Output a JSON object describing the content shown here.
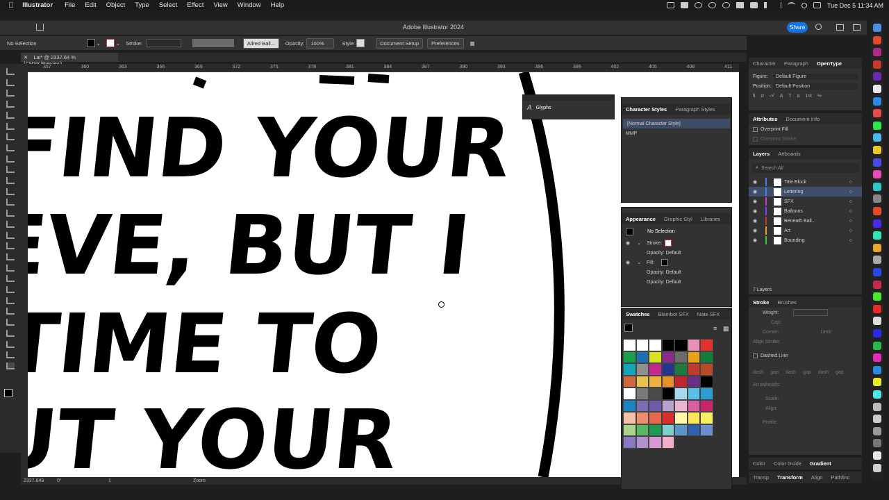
{
  "menubar": {
    "app": "Illustrator",
    "items": [
      "File",
      "Edit",
      "Object",
      "Type",
      "Select",
      "Effect",
      "View",
      "Window",
      "Help"
    ],
    "clock": "Tue Dec 5  11:34 AM"
  },
  "window": {
    "title": "Adobe Illustrator 2024",
    "share_label": "Share"
  },
  "control": {
    "selection": "No Selection",
    "stroke_label": "Stroke:",
    "font": "Allred Ball...",
    "opacity_label": "Opacity:",
    "opacity_value": "100%",
    "style_label": "Style:",
    "doc_setup": "Document Setup",
    "preferences": "Preferences"
  },
  "document_tab": "Lai* @ 2337.64 % (CMYK/Preview)",
  "ruler": [
    "357",
    "360",
    "363",
    "366",
    "369",
    "372",
    "375",
    "378",
    "381",
    "384",
    "387",
    "390",
    "393",
    "396",
    "399",
    "402",
    "405",
    "408",
    "411"
  ],
  "canvas_text": [
    "FIND YOUR",
    "EVE, BUT I",
    "TIME TO",
    "UT YOUR"
  ],
  "status": {
    "zoom": "2337.649",
    "angle": "0°",
    "artboard": "1",
    "tool": "Zoom"
  },
  "glyphs_panel": {
    "title": "Glyphs"
  },
  "char_styles_panel": {
    "tabs": [
      "Character Styles",
      "Paragraph Styles"
    ],
    "items": [
      "[Normal Character Style]",
      "MMP"
    ]
  },
  "appearance_panel": {
    "tabs": [
      "Appearance",
      "Graphic Styl",
      "Libraries"
    ],
    "selection": "No Selection",
    "stroke_label": "Stroke:",
    "fill_label": "Fill:",
    "opacity_rows": [
      "Opacity: Default",
      "Opacity: Default",
      "Opacity: Default"
    ]
  },
  "swatches_panel": {
    "tabs": [
      "Swatches",
      "Blambot SFX",
      "Nate SFX"
    ],
    "colors": [
      "#ffffff",
      "#ffffff",
      "#ffffff",
      "#000000",
      "#000000",
      "#e991b4",
      "#e2322b",
      "#1aa04a",
      "#1e6fb2",
      "#d9e21f",
      "#8a2a8a",
      "#6b6b6b",
      "#e6a318",
      "#137e3b",
      "#14a6b8",
      "#8f8f8f",
      "#c02a8c",
      "#26358f",
      "#1c7a3e",
      "#c23a2a",
      "#b84b27",
      "#d06a3a",
      "#e8c24a",
      "#f0b23d",
      "#e8912a",
      "#c2262b",
      "#6a2e8a",
      "#000000",
      "#ffffff",
      "#7a7a7a",
      "#4a4a4a",
      "#000000",
      "#a8d8ee",
      "#58c1e8",
      "#2a9fd6",
      "#1a85c2",
      "#7b6fb2",
      "#6e5aa6",
      "#b8a0cf",
      "#e9b5d2",
      "#dc5ea2",
      "#c8256d",
      "#f4c1a6",
      "#ef8e6f",
      "#e86a4d",
      "#d92e2d",
      "#fff7a8",
      "#fbe65a",
      "#f6ef63",
      "#a8d48c",
      "#59b866",
      "#1f9a52",
      "#7fd0cc",
      "#5c95c9",
      "#2f62ad",
      "#6b8fcf",
      "#8a78c2",
      "#b38fcf",
      "#d49ad1",
      "#f1afc9"
    ]
  },
  "right_panels": {
    "type_tabs": [
      "Character",
      "Paragraph",
      "OpenType"
    ],
    "figure_label": "Figure:",
    "figure_value": "Default Figure",
    "position_label": "Position:",
    "position_value": "Default Position",
    "attr_tabs": [
      "Attributes",
      "Document Info"
    ],
    "overprint_fill": "Overprint Fill",
    "overprint_stroke": "Overprint Stroke",
    "layer_tabs": [
      "Layers",
      "Artboards"
    ],
    "search_placeholder": "Search All",
    "layers": [
      {
        "name": "Title Block",
        "color": "#4a7cf0"
      },
      {
        "name": "Lettering",
        "color": "#4a7cf0"
      },
      {
        "name": "SFX",
        "color": "#c83ac8"
      },
      {
        "name": "Balloons",
        "color": "#7a4af0"
      },
      {
        "name": "Beneath Ball...",
        "color": "#c8392b"
      },
      {
        "name": "Art",
        "color": "#e3a32b"
      },
      {
        "name": "Bounding",
        "color": "#3ac83a"
      }
    ],
    "layer_count": "7 Layers",
    "stroke_tabs": [
      "Stroke",
      "Brushes"
    ],
    "weight_label": "Weight:",
    "cap_label": "Cap:",
    "corner_label": "Corner:",
    "limit_label": "Limit:",
    "align_stroke_label": "Align Stroke:",
    "dashed_line": "Dashed Line",
    "dash_labels": [
      "dash",
      "gap",
      "dash",
      "gap",
      "dash",
      "gap"
    ],
    "arrowheads_label": "Arrowheads:",
    "scale_label": "Scale:",
    "align_label": "Align:",
    "profile_label": "Profile:",
    "color_tabs": [
      "Color",
      "Color Guide",
      "Gradient"
    ],
    "bottom_tabs": [
      "Transp",
      "Transform",
      "Align",
      "Pathfinc"
    ]
  }
}
